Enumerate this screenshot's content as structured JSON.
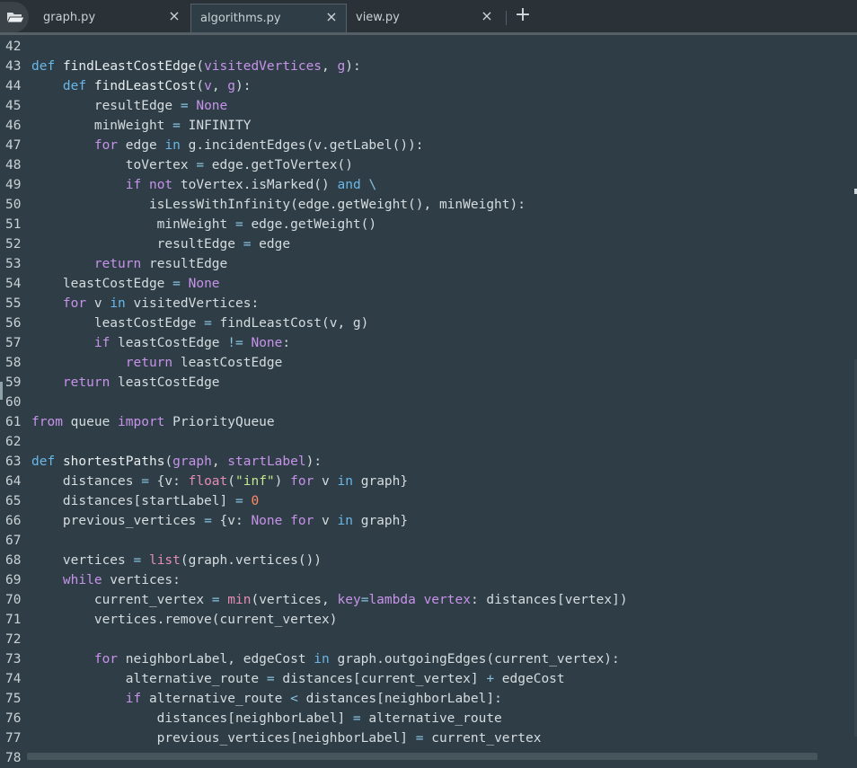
{
  "tabs": [
    {
      "label": "graph.py",
      "active": false
    },
    {
      "label": "algorithms.py",
      "active": true
    },
    {
      "label": "view.py",
      "active": false
    }
  ],
  "new_tab_icon": "plus-icon",
  "folder_icon": "folder-open-icon",
  "close_icon_glyph": "×",
  "lines": [
    {
      "n": "42",
      "html": ""
    },
    {
      "n": "43",
      "html": "<span class='kw2'>def</span> <span class='fn'>findLeastCostEdge</span>(<span class='par'>visitedVertices</span>, <span class='par'>g</span>):"
    },
    {
      "n": "44",
      "html": "    <span class='kw2'>def</span> <span class='fn'>findLeastCost</span>(<span class='par'>v</span>, <span class='par'>g</span>):"
    },
    {
      "n": "45",
      "html": "        resultEdge <span class='op'>=</span> <span class='kw'>None</span>"
    },
    {
      "n": "46",
      "html": "        minWeight <span class='op'>=</span> INFINITY"
    },
    {
      "n": "47",
      "html": "        <span class='kw'>for</span> edge <span class='kw2'>in</span> g.incidentEdges(v.getLabel()):"
    },
    {
      "n": "48",
      "html": "            toVertex <span class='op'>=</span> edge.getToVertex()"
    },
    {
      "n": "49",
      "html": "            <span class='kw'>if</span> <span class='kw'>not</span> toVertex.isMarked() <span class='kw2'>and</span> <span class='op'>\\</span>"
    },
    {
      "n": "50",
      "html": "               isLessWithInfinity(edge.getWeight(), minWeight):"
    },
    {
      "n": "51",
      "html": "                minWeight <span class='op'>=</span> edge.getWeight()"
    },
    {
      "n": "52",
      "html": "                resultEdge <span class='op'>=</span> edge"
    },
    {
      "n": "53",
      "html": "        <span class='kw'>return</span> resultEdge"
    },
    {
      "n": "54",
      "html": "    leastCostEdge <span class='op'>=</span> <span class='kw'>None</span>"
    },
    {
      "n": "55",
      "html": "    <span class='kw'>for</span> v <span class='kw2'>in</span> visitedVertices:"
    },
    {
      "n": "56",
      "html": "        leastCostEdge <span class='op'>=</span> findLeastCost(v, g)"
    },
    {
      "n": "57",
      "html": "        <span class='kw'>if</span> leastCostEdge <span class='op'>!=</span> <span class='kw'>None</span>:"
    },
    {
      "n": "58",
      "html": "            <span class='kw'>return</span> leastCostEdge"
    },
    {
      "n": "59",
      "html": "    <span class='kw'>return</span> leastCostEdge"
    },
    {
      "n": "60",
      "html": ""
    },
    {
      "n": "61",
      "html": "<span class='kw'>from</span> queue <span class='kw'>import</span> PriorityQueue"
    },
    {
      "n": "62",
      "html": ""
    },
    {
      "n": "63",
      "html": "<span class='kw2'>def</span> <span class='fn'>shortestPaths</span>(<span class='par'>graph</span>, <span class='par'>startLabel</span>):"
    },
    {
      "n": "64",
      "html": "    distances <span class='op'>=</span> {v: <span class='bi'>float</span>(<span class='str'>\"inf\"</span>) <span class='kw'>for</span> v <span class='kw2'>in</span> graph}"
    },
    {
      "n": "65",
      "html": "    distances[startLabel] <span class='op'>=</span> <span class='num'>0</span>"
    },
    {
      "n": "66",
      "html": "    previous_vertices <span class='op'>=</span> {v: <span class='kw'>None</span> <span class='kw'>for</span> v <span class='kw2'>in</span> graph}"
    },
    {
      "n": "67",
      "html": ""
    },
    {
      "n": "68",
      "html": "    vertices <span class='op'>=</span> <span class='bi'>list</span>(graph.vertices())"
    },
    {
      "n": "69",
      "html": "    <span class='kw'>while</span> vertices:"
    },
    {
      "n": "70",
      "html": "        current_vertex <span class='op'>=</span> <span class='bi'>min</span>(vertices, <span class='par'>key</span><span class='op'>=</span><span class='kw'>lambda</span> <span class='par'>vertex</span>: distances[vertex])"
    },
    {
      "n": "71",
      "html": "        vertices.remove(current_vertex)"
    },
    {
      "n": "72",
      "html": ""
    },
    {
      "n": "73",
      "html": "        <span class='kw'>for</span> neighborLabel, edgeCost <span class='kw2'>in</span> graph.outgoingEdges(current_vertex):"
    },
    {
      "n": "74",
      "html": "            alternative_route <span class='op'>=</span> distances[current_vertex] <span class='op'>+</span> edgeCost"
    },
    {
      "n": "75",
      "html": "            <span class='kw'>if</span> alternative_route <span class='op'>&lt;</span> distances[neighborLabel]:"
    },
    {
      "n": "76",
      "html": "                distances[neighborLabel] <span class='op'>=</span> alternative_route"
    },
    {
      "n": "77",
      "html": "                previous_vertices[neighborLabel] <span class='op'>=</span> current_vertex"
    },
    {
      "n": "78",
      "html": ""
    }
  ],
  "colors": {
    "editor_bg": "#2f3e46",
    "tabbar_bg": "#2a3137",
    "keyword": "#c792ea",
    "keyword_alt": "#69b7e8",
    "string": "#c3e88d",
    "number": "#ff8a65"
  }
}
